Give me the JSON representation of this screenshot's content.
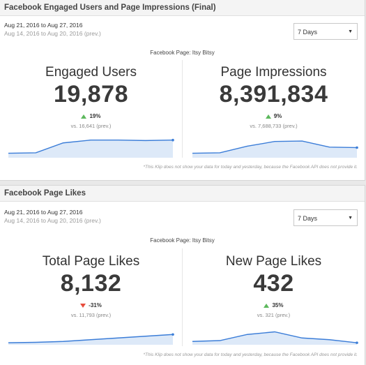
{
  "klip1": {
    "title": "Facebook Engaged Users and Page Impressions (Final)",
    "date_current": "Aug 21, 2016 to Aug 27, 2016",
    "date_previous": "Aug 14, 2016 to Aug 20, 2016 (prev.)",
    "range": "7 Days",
    "page_label": "Facebook Page: Itsy Bitsy",
    "left": {
      "name": "Engaged Users",
      "value": "19,878",
      "change": "19%",
      "direction": "up",
      "vs": "vs. 16,641 (prev.)",
      "spark": [
        8,
        9,
        30,
        36,
        36,
        35,
        36
      ]
    },
    "right": {
      "name": "Page Impressions",
      "value": "8,391,834",
      "change": "9%",
      "direction": "up",
      "vs": "vs. 7,688,733 (prev.)",
      "spark": [
        8,
        9,
        23,
        33,
        34,
        21,
        20
      ]
    },
    "footnote": "*This Klip does not show your data for today and yesterday, because the Facebook API does not provide it."
  },
  "klip2": {
    "title": "Facebook Page Likes",
    "date_current": "Aug 21, 2016 to Aug 27, 2016",
    "date_previous": "Aug 14, 2016 to Aug 20, 2016 (prev.)",
    "range": "7 Days",
    "page_label": "Facebook Page: Itsy Bitsy",
    "left": {
      "name": "Total Page Likes",
      "value": "8,132",
      "change": "-31%",
      "direction": "down",
      "vs": "vs. 11,793 (prev.)",
      "spark": [
        3,
        4,
        6,
        10,
        14,
        18,
        22
      ]
    },
    "right": {
      "name": "New Page Likes",
      "value": "432",
      "change": "35%",
      "direction": "up",
      "vs": "vs. 321 (prev.)",
      "spark": [
        6,
        8,
        22,
        28,
        14,
        10,
        3
      ]
    },
    "footnote": "*This Klip does not show your data for today and yesterday, because the Facebook API does not provide it."
  },
  "colors": {
    "spark_line": "#3b7dd8",
    "spark_fill": "#dde9f8",
    "up": "#5cb85c",
    "down": "#e74c3c"
  }
}
